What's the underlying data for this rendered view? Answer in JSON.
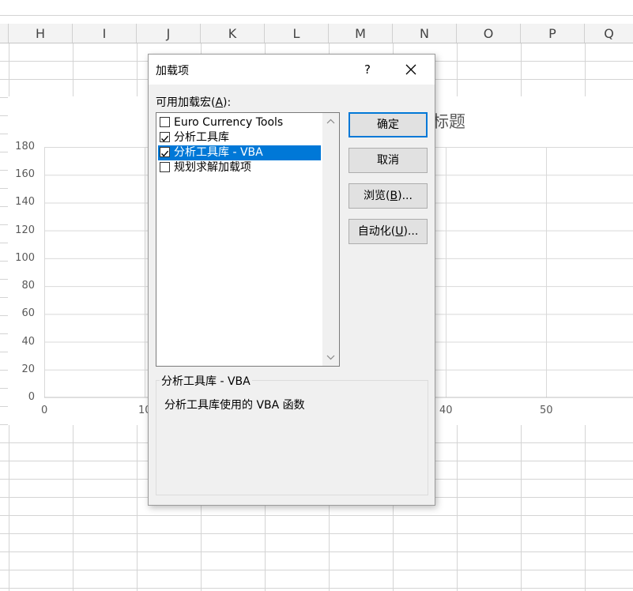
{
  "spreadsheet": {
    "columns": [
      "H",
      "I",
      "J",
      "K",
      "L",
      "M",
      "N",
      "O",
      "P",
      "Q"
    ]
  },
  "chart_data": {
    "type": "scatter",
    "title": "标题",
    "y_ticks": [
      "180",
      "160",
      "140",
      "120",
      "100",
      "80",
      "60",
      "40",
      "20",
      "0"
    ],
    "x_ticks": [
      "0",
      "10",
      "40",
      "50"
    ],
    "ylim": [
      0,
      180
    ],
    "grid": true,
    "series": []
  },
  "dialog": {
    "title": "加载项",
    "help_label": "?",
    "list_label_pre": "可用加载宏(",
    "list_label_key": "A",
    "list_label_post": "):",
    "items": [
      {
        "label": "Euro Currency Tools",
        "checked": false,
        "selected": false
      },
      {
        "label": "分析工具库",
        "checked": true,
        "selected": false
      },
      {
        "label": "分析工具库 - VBA",
        "checked": true,
        "selected": true
      },
      {
        "label": "规划求解加载项",
        "checked": false,
        "selected": false
      }
    ],
    "buttons": {
      "ok": "确定",
      "cancel": "取消",
      "browse_pre": "浏览(",
      "browse_key": "B",
      "browse_post": ")...",
      "automation_pre": "自动化(",
      "automation_key": "U",
      "automation_post": ")..."
    },
    "group_title": "分析工具库 - VBA",
    "description": "分析工具库使用的 VBA 函数"
  },
  "colors": {
    "selection": "#0078d7",
    "dialog_bg": "#f0f0f0",
    "grid": "#d4d4d4"
  }
}
